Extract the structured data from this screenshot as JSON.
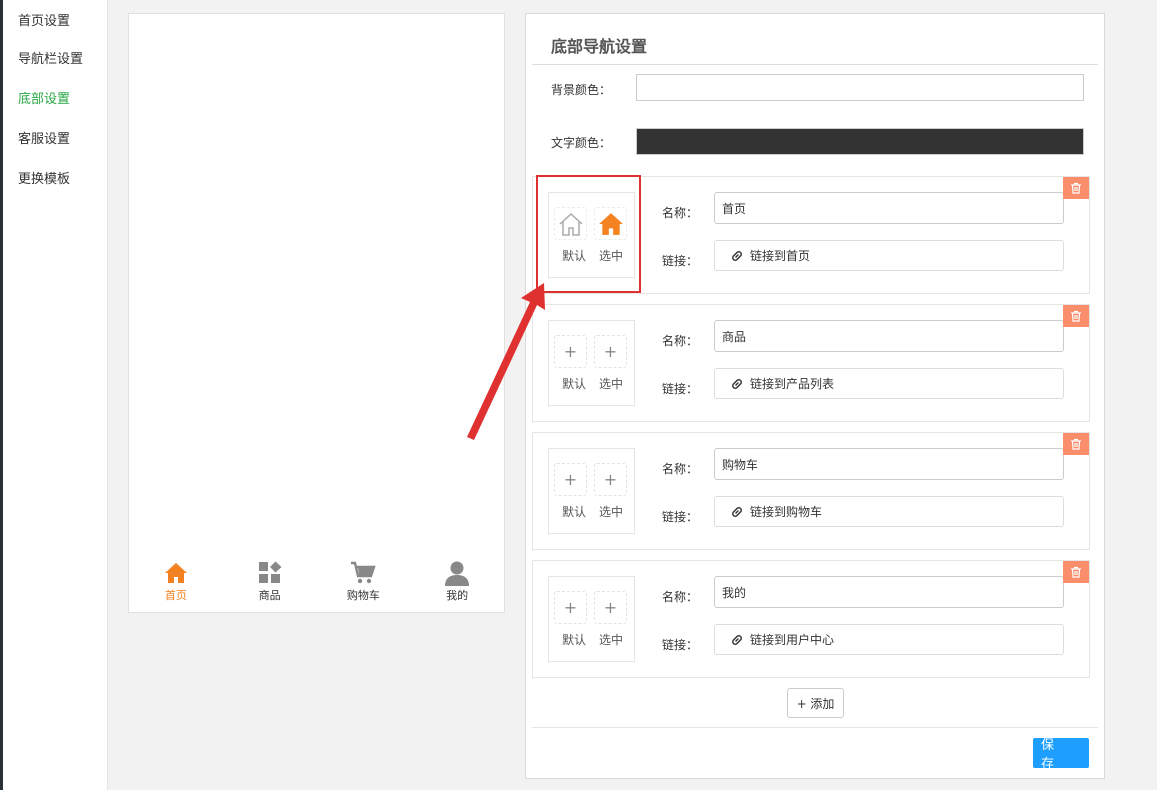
{
  "sidebar": {
    "items": [
      {
        "label": "首页设置"
      },
      {
        "label": "导航栏设置"
      },
      {
        "label": "底部设置",
        "active": true
      },
      {
        "label": "客服设置"
      },
      {
        "label": "更换模板"
      }
    ]
  },
  "preview": {
    "tabs": [
      {
        "label": "首页",
        "icon": "home-icon",
        "active": true
      },
      {
        "label": "商品",
        "icon": "grid-icon"
      },
      {
        "label": "购物车",
        "icon": "cart-icon"
      },
      {
        "label": "我的",
        "icon": "user-icon"
      }
    ]
  },
  "panel": {
    "title": "底部导航设置",
    "bg_color_label": "背景颜色：",
    "bg_color_value": "#ffffff",
    "text_color_label": "文字颜色：",
    "text_color_value": "#333333",
    "default_label": "默认",
    "selected_label": "选中",
    "name_label": "名称：",
    "link_label": "链接：",
    "items": [
      {
        "name": "首页",
        "link": "链接到首页",
        "has_icons": true
      },
      {
        "name": "商品",
        "link": "链接到产品列表",
        "has_icons": false
      },
      {
        "name": "购物车",
        "link": "链接到购物车",
        "has_icons": false
      },
      {
        "name": "我的",
        "link": "链接到用户中心",
        "has_icons": false
      }
    ],
    "add_label": "+ 添加",
    "save_label": "保 存"
  },
  "colors": {
    "accent_orange": "#f58220",
    "active_green": "#2aa845",
    "delete_orange": "#f88e6a",
    "save_blue": "#1e9fff",
    "annotation_red": "#e03131"
  }
}
